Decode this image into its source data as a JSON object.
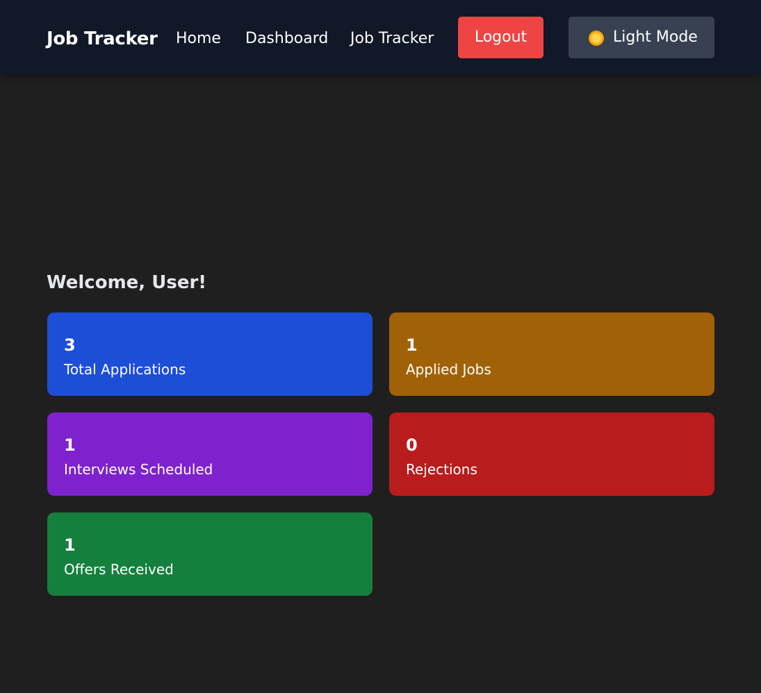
{
  "nav": {
    "brand": "Job Tracker",
    "links": [
      "Home",
      "Dashboard",
      "Job Tracker"
    ],
    "logout_label": "Logout",
    "mode_toggle_label": "Light Mode",
    "mode_icon": "sun-icon"
  },
  "main": {
    "welcome": "Welcome, User!",
    "stats": [
      {
        "count": "3",
        "label": "Total Applications",
        "color": "#1d4ed8"
      },
      {
        "count": "1",
        "label": "Applied Jobs",
        "color": "#a16207"
      },
      {
        "count": "1",
        "label": "Interviews Scheduled",
        "color": "#7e22ce"
      },
      {
        "count": "0",
        "label": "Rejections",
        "color": "#b91c1c"
      },
      {
        "count": "1",
        "label": "Offers Received",
        "color": "#15803d"
      }
    ]
  },
  "colors": {
    "page_bg": "#1f1f1f",
    "navbar_bg": "#111827",
    "logout_bg": "#ef4444",
    "mode_btn_bg": "#374151"
  }
}
